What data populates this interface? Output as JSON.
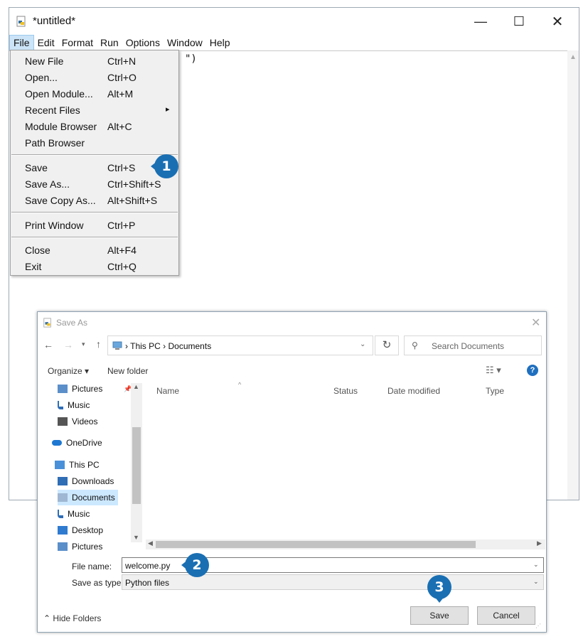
{
  "idle": {
    "title": "*untitled*",
    "menubar": [
      "File",
      "Edit",
      "Format",
      "Run",
      "Options",
      "Window",
      "Help"
    ],
    "code_visible": "\")"
  },
  "file_menu": {
    "groups": [
      [
        {
          "label": "New File",
          "shortcut": "Ctrl+N"
        },
        {
          "label": "Open...",
          "shortcut": "Ctrl+O"
        },
        {
          "label": "Open Module...",
          "shortcut": "Alt+M"
        },
        {
          "label": "Recent Files",
          "shortcut": "",
          "submenu": "▸"
        },
        {
          "label": "Module Browser",
          "shortcut": "Alt+C"
        },
        {
          "label": "Path Browser",
          "shortcut": ""
        }
      ],
      [
        {
          "label": "Save",
          "shortcut": "Ctrl+S"
        },
        {
          "label": "Save As...",
          "shortcut": "Ctrl+Shift+S"
        },
        {
          "label": "Save Copy As...",
          "shortcut": "Alt+Shift+S"
        }
      ],
      [
        {
          "label": "Print Window",
          "shortcut": "Ctrl+P"
        }
      ],
      [
        {
          "label": "Close",
          "shortcut": "Alt+F4"
        },
        {
          "label": "Exit",
          "shortcut": "Ctrl+Q"
        }
      ]
    ]
  },
  "callouts": [
    "1",
    "2",
    "3"
  ],
  "callout_color": "#1a6fb3",
  "save_as": {
    "title": "Save As",
    "address": {
      "parts": [
        "This PC",
        "Documents"
      ],
      "sep": "›"
    },
    "search_placeholder": "Search Documents",
    "organize": "Organize ▾",
    "new_folder": "New folder",
    "help": "?",
    "nav_items": [
      {
        "label": "Pictures",
        "icon": "pictures-icon",
        "pin": "📌"
      },
      {
        "label": "Music",
        "icon": "music-icon"
      },
      {
        "label": "Videos",
        "icon": "videos-icon"
      },
      {
        "label": "OneDrive",
        "icon": "onedrive-icon"
      },
      {
        "label": "This PC",
        "icon": "this-pc-icon"
      },
      {
        "label": "Downloads",
        "icon": "downloads-icon"
      },
      {
        "label": "Documents",
        "icon": "documents-icon",
        "selected": true
      },
      {
        "label": "Music",
        "icon": "music-icon"
      },
      {
        "label": "Desktop",
        "icon": "desktop-icon"
      },
      {
        "label": "Pictures",
        "icon": "pictures-icon"
      }
    ],
    "columns": [
      "Name",
      "Status",
      "Date modified",
      "Type"
    ],
    "file_name_label": "File name:",
    "file_name_value": "welcome.py",
    "save_type_label": "Save as type:",
    "save_type_value": "Python files",
    "hide_folders": "Hide Folders",
    "save_label": "Save",
    "cancel_label": "Cancel"
  }
}
